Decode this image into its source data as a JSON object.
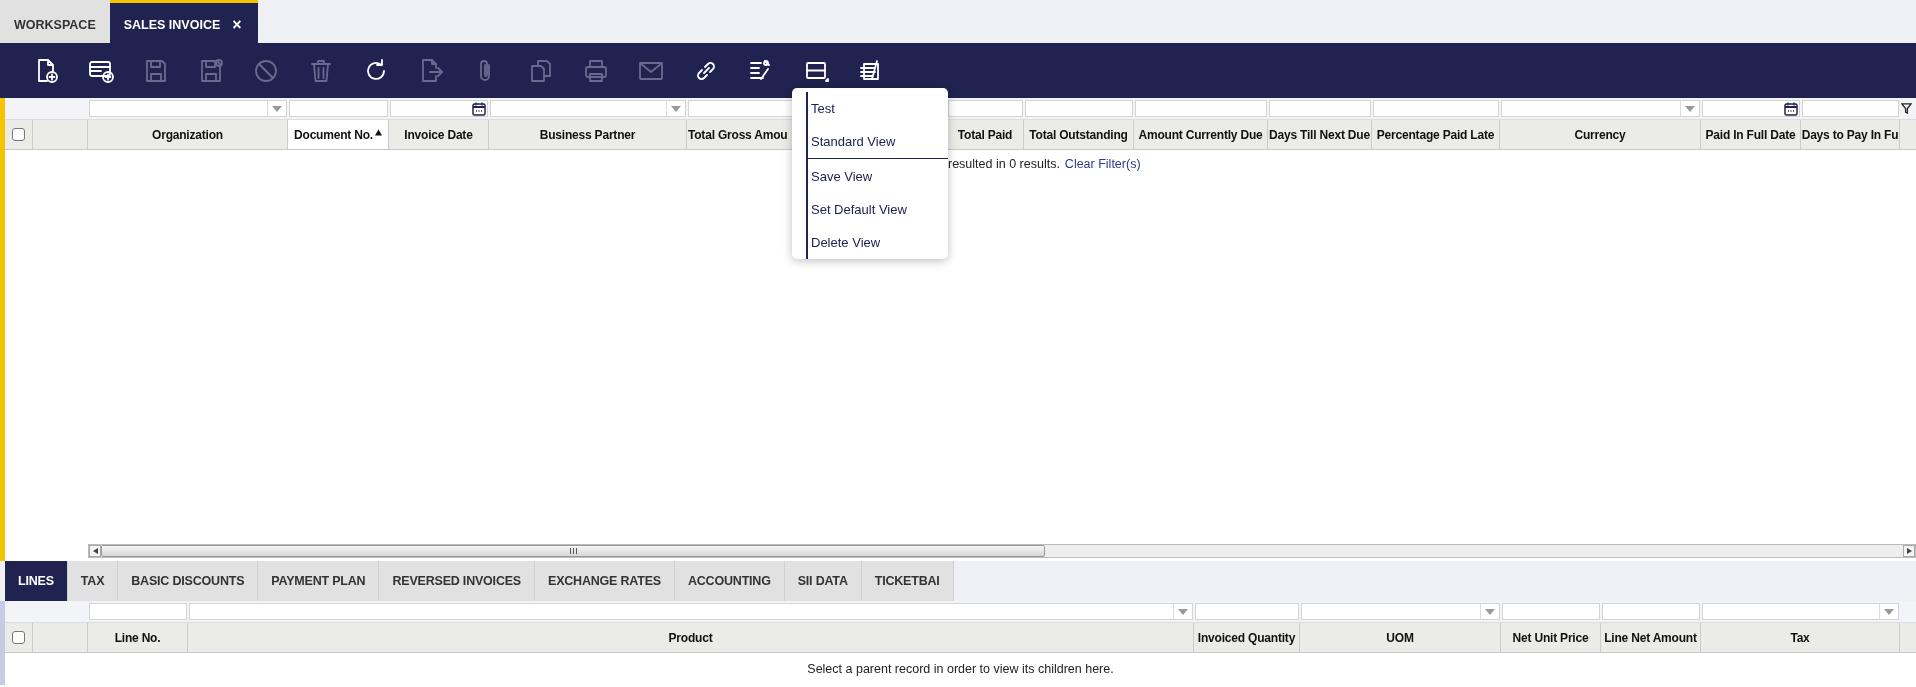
{
  "window_tabs": [
    {
      "label": "WORKSPACE",
      "selected": false
    },
    {
      "label": "SALES INVOICE",
      "selected": true,
      "close_label": "×"
    }
  ],
  "toolbar": [
    {
      "kind": "new-document",
      "disabled": false
    },
    {
      "kind": "new-record",
      "disabled": false
    },
    {
      "kind": "save",
      "disabled": true
    },
    {
      "kind": "save-close",
      "disabled": true
    },
    {
      "kind": "cancel",
      "disabled": true
    },
    {
      "kind": "delete",
      "disabled": true
    },
    {
      "kind": "refresh",
      "disabled": false
    },
    {
      "kind": "export",
      "disabled": true
    },
    {
      "kind": "attach",
      "disabled": true
    },
    {
      "kind": "clone",
      "disabled": true
    },
    {
      "kind": "print",
      "disabled": true
    },
    {
      "kind": "email",
      "disabled": true
    },
    {
      "kind": "link",
      "disabled": false
    },
    {
      "kind": "tools",
      "disabled": false
    },
    {
      "kind": "views",
      "disabled": false
    },
    {
      "kind": "notes",
      "disabled": false
    }
  ],
  "main_grid": {
    "select_all": {
      "checked": false
    },
    "columns": [
      {
        "label": "Organization",
        "kind": "dropdown",
        "sorted": false
      },
      {
        "label": "Document No.",
        "kind": "text",
        "sorted": true
      },
      {
        "label": "Invoice Date",
        "kind": "date",
        "sorted": false
      },
      {
        "label": "Business Partner",
        "kind": "dropdown",
        "sorted": false
      },
      {
        "label": "Total Gross Amou",
        "kind": "text",
        "sorted": false
      },
      {
        "label": "Total Paid",
        "kind": "text",
        "sorted": false
      },
      {
        "label": "Total Outstanding",
        "kind": "text",
        "sorted": false
      },
      {
        "label": "Amount Currently Due",
        "kind": "text",
        "sorted": false
      },
      {
        "label": "Days Till Next Due",
        "kind": "text",
        "sorted": false
      },
      {
        "label": "Percentage Paid Late",
        "kind": "text",
        "sorted": false
      },
      {
        "label": "Currency",
        "kind": "dropdown",
        "sorted": false
      },
      {
        "label": "Paid In Full Date",
        "kind": "date",
        "sorted": false
      },
      {
        "label": "Days to Pay In Fu",
        "kind": "text",
        "sorted": false
      }
    ],
    "message": "resulted in 0 results.",
    "clear_filter": "Clear Filter(s)"
  },
  "view_menu": {
    "sections": [
      {
        "items": [
          {
            "label": "Test"
          },
          {
            "label": "Standard View"
          }
        ]
      },
      {
        "items": [
          {
            "label": "Save View"
          },
          {
            "label": "Set Default View"
          },
          {
            "label": "Delete View"
          }
        ]
      }
    ]
  },
  "detail_tabs": [
    {
      "label": "LINES",
      "selected": true
    },
    {
      "label": "TAX",
      "selected": false
    },
    {
      "label": "BASIC DISCOUNTS",
      "selected": false
    },
    {
      "label": "PAYMENT PLAN",
      "selected": false
    },
    {
      "label": "REVERSED INVOICES",
      "selected": false
    },
    {
      "label": "EXCHANGE RATES",
      "selected": false
    },
    {
      "label": "ACCOUNTING",
      "selected": false
    },
    {
      "label": "SII DATA",
      "selected": false
    },
    {
      "label": "TICKETBAI",
      "selected": false
    }
  ],
  "detail_grid": {
    "select_all": {
      "checked": false
    },
    "columns": [
      {
        "label": "Line No.",
        "kind": "text",
        "sorted": false
      },
      {
        "label": "Product",
        "kind": "dropdown",
        "sorted": false
      },
      {
        "label": "Invoiced Quantity",
        "kind": "text",
        "sorted": false
      },
      {
        "label": "UOM",
        "kind": "dropdown",
        "sorted": false
      },
      {
        "label": "Net Unit Price",
        "kind": "text",
        "sorted": false
      },
      {
        "label": "Line Net Amount",
        "kind": "text",
        "sorted": false
      },
      {
        "label": "Tax",
        "kind": "dropdown",
        "sorted": false
      }
    ],
    "message": "Select a parent record in order to view its children here."
  }
}
